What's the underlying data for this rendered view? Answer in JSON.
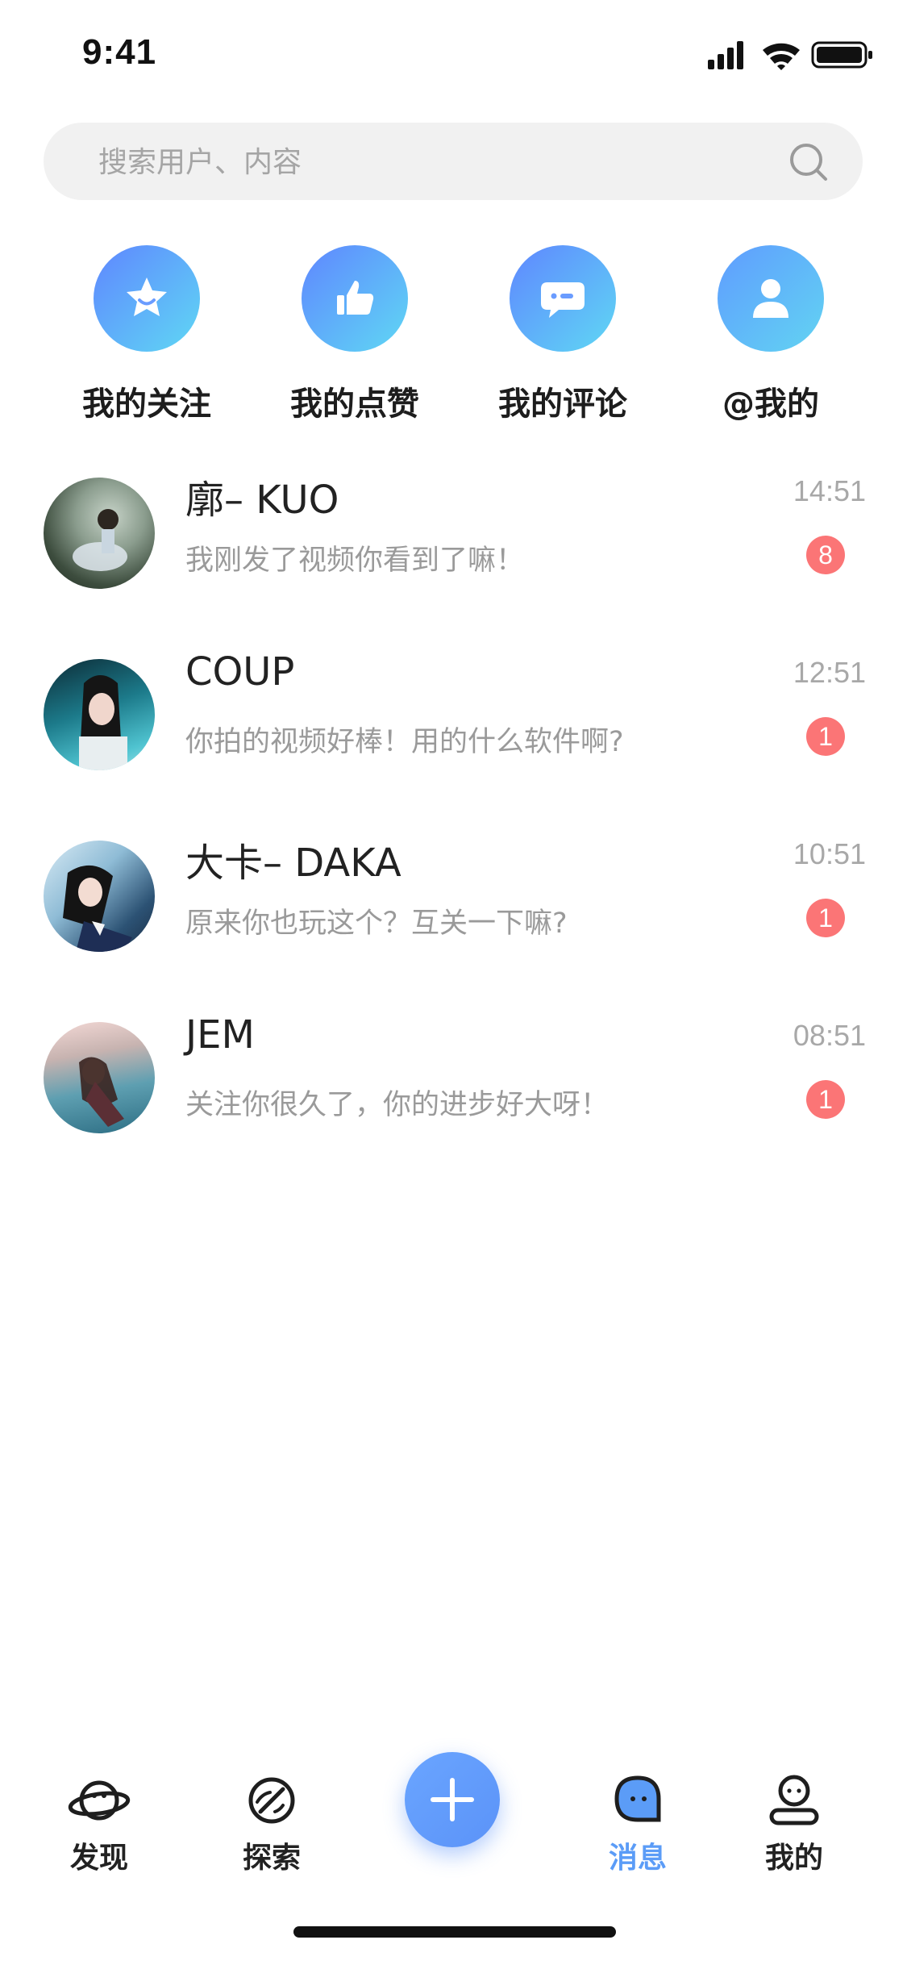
{
  "status_bar": {
    "time": "9:41"
  },
  "search": {
    "placeholder": "搜索用户、内容"
  },
  "quick_actions": [
    {
      "label": "我的关注",
      "icon": "star-icon"
    },
    {
      "label": "我的点赞",
      "icon": "thumbs-up-icon"
    },
    {
      "label": "我的评论",
      "icon": "comment-icon"
    },
    {
      "label": "@我的",
      "icon": "user-icon"
    }
  ],
  "messages": [
    {
      "name": "廓– KUO",
      "preview": "我刚发了视频你看到了嘛！",
      "time": "14:51",
      "unread": "8"
    },
    {
      "name": "COUP",
      "preview": "你拍的视频好棒！用的什么软件啊?",
      "time": "12:51",
      "unread": "1"
    },
    {
      "name": "大卡– DAKA",
      "preview": "原来你也玩这个？互关一下嘛?",
      "time": "10:51",
      "unread": "1"
    },
    {
      "name": "JEM",
      "preview": "关注你很久了，你的进步好大呀！",
      "time": "08:51",
      "unread": "1"
    }
  ],
  "tab_bar": {
    "discover": "发现",
    "explore": "探索",
    "messages": "消息",
    "mine": "我的",
    "active": "messages"
  },
  "colors": {
    "accent": "#5b9cf7",
    "badge": "#fb7576",
    "gradient_start": "#5f86ff",
    "gradient_end": "#5fd8f4"
  }
}
